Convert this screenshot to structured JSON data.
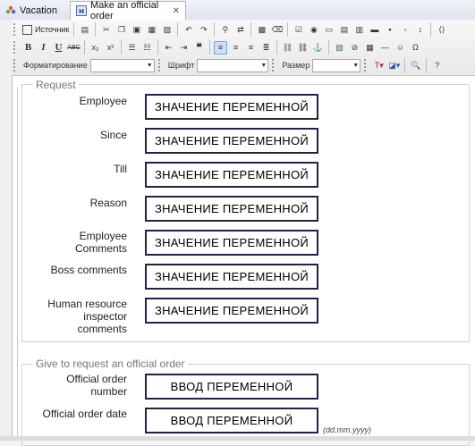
{
  "tabs": [
    {
      "label": "Vacation",
      "active": false
    },
    {
      "label": "Make an official order",
      "active": true
    }
  ],
  "toolbar": {
    "source_label": "Источник",
    "format_label": "Форматирование",
    "font_label": "Шрифт",
    "size_label": "Размер",
    "bold": "B",
    "italic": "I",
    "underline": "U",
    "strike": "ABC",
    "subscript": "x₂",
    "superscript": "x²"
  },
  "request_section": {
    "legend": "Request",
    "fields": [
      {
        "label": "Employee",
        "value": "ЗНАЧЕНИЕ ПЕРЕМЕННОЙ"
      },
      {
        "label": "Since",
        "value": "ЗНАЧЕНИЕ ПЕРЕМЕННОЙ"
      },
      {
        "label": "Till",
        "value": "ЗНАЧЕНИЕ ПЕРЕМЕННОЙ"
      },
      {
        "label": "Reason",
        "value": "ЗНАЧЕНИЕ ПЕРЕМЕННОЙ"
      },
      {
        "label_lines": [
          "Employee",
          "Comments"
        ],
        "value": "ЗНАЧЕНИЕ ПЕРЕМЕННОЙ"
      },
      {
        "label": "Boss comments",
        "value": "ЗНАЧЕНИЕ ПЕРЕМЕННОЙ"
      },
      {
        "label_lines": [
          "Human resource",
          "inspector",
          "comments"
        ],
        "value": "ЗНАЧЕНИЕ ПЕРЕМЕННОЙ"
      }
    ]
  },
  "order_section": {
    "legend": "Give to request an official order",
    "fields": [
      {
        "label_lines": [
          "Official order",
          "number"
        ],
        "value": "ВВОД ПЕРЕМЕННОЙ"
      },
      {
        "label": "Official order date",
        "value": "ВВОД ПЕРЕМЕННОЙ",
        "hint": "(dd.mm.yyyy)"
      }
    ]
  }
}
